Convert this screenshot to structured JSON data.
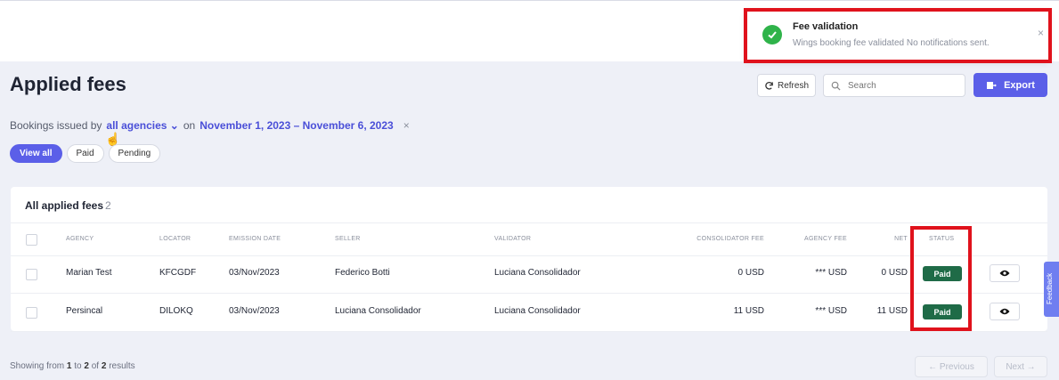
{
  "toast": {
    "title": "Fee validation",
    "message": "Wings booking fee validated No notifications sent.",
    "close": "×",
    "icon": "check-circle-icon",
    "color": "#2fb34a"
  },
  "header": {
    "title": "Applied fees",
    "refresh_label": "Refresh",
    "search_placeholder": "Search",
    "export_label": "Export",
    "accent": "#5b5fe8"
  },
  "filters": {
    "prefix": "Bookings issued by",
    "agency": "all agencies",
    "on": "on",
    "date_range": "November 1, 2023 – November 6, 2023",
    "clear": "×",
    "pills": [
      "View all",
      "Paid",
      "Pending"
    ],
    "active_pill": "View all"
  },
  "table": {
    "title": "All applied fees",
    "count": "2",
    "columns": [
      "AGENCY",
      "LOCATOR",
      "EMISSION DATE",
      "SELLER",
      "VALIDATOR",
      "CONSOLIDATOR FEE",
      "AGENCY FEE",
      "NET",
      "STATUS"
    ],
    "rows": [
      {
        "agency": "Marian Test",
        "locator": "KFCGDF",
        "date": "03/Nov/2023",
        "seller": "Federico Botti",
        "validator": "Luciana Consolidador",
        "consolidator_fee": "0 USD",
        "agency_fee": "*** USD",
        "net": "0 USD",
        "status": "Paid"
      },
      {
        "agency": "Persincal",
        "locator": "DILOKQ",
        "date": "03/Nov/2023",
        "seller": "Luciana Consolidador",
        "validator": "Luciana Consolidador",
        "consolidator_fee": "11 USD",
        "agency_fee": "*** USD",
        "net": "11 USD",
        "status": "Paid"
      }
    ],
    "status_color": "#1f6b47"
  },
  "footer": {
    "prefix": "Showing from",
    "from": "1",
    "to_word": "to",
    "to": "2",
    "of_word": "of",
    "total": "2",
    "suffix": "results",
    "previous": "← Previous",
    "next": "Next →"
  },
  "feedback_tab": "Feedback",
  "highlight_color": "#e0121c"
}
